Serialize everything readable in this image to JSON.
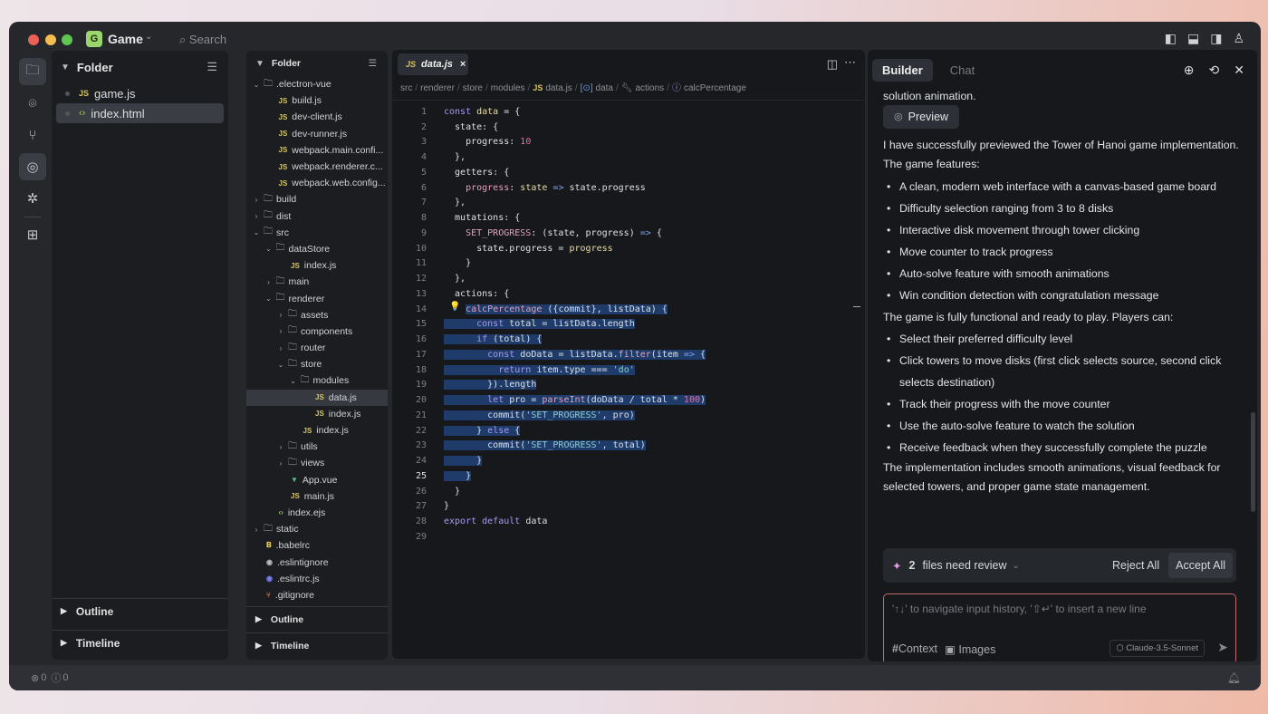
{
  "titlebar": {
    "app_letter": "G",
    "app_name": "Game",
    "search_placeholder": "Search"
  },
  "left_panel": {
    "title": "Folder",
    "files": [
      {
        "icon": "js",
        "name": "game.js"
      },
      {
        "icon": "html",
        "name": "index.html",
        "selected": true
      }
    ],
    "outline": "Outline",
    "timeline": "Timeline"
  },
  "tree": {
    "title": "Folder",
    "items": [
      {
        "d": 0,
        "t": "folder",
        "open": true,
        "name": ".electron-vue"
      },
      {
        "d": 1,
        "t": "js",
        "name": "build.js"
      },
      {
        "d": 1,
        "t": "js",
        "name": "dev-client.js"
      },
      {
        "d": 1,
        "t": "js",
        "name": "dev-runner.js"
      },
      {
        "d": 1,
        "t": "js",
        "name": "webpack.main.confi..."
      },
      {
        "d": 1,
        "t": "js",
        "name": "webpack.renderer.c..."
      },
      {
        "d": 1,
        "t": "js",
        "name": "webpack.web.config..."
      },
      {
        "d": 0,
        "t": "folder",
        "open": false,
        "name": "build"
      },
      {
        "d": 0,
        "t": "folder",
        "open": false,
        "name": "dist"
      },
      {
        "d": 0,
        "t": "folder",
        "open": true,
        "name": "src"
      },
      {
        "d": 1,
        "t": "folder",
        "open": true,
        "name": "dataStore"
      },
      {
        "d": 2,
        "t": "js",
        "name": "index.js"
      },
      {
        "d": 1,
        "t": "folder",
        "open": false,
        "name": "main"
      },
      {
        "d": 1,
        "t": "folder",
        "open": true,
        "name": "renderer"
      },
      {
        "d": 2,
        "t": "folder",
        "open": false,
        "name": "assets"
      },
      {
        "d": 2,
        "t": "folder",
        "open": false,
        "name": "components"
      },
      {
        "d": 2,
        "t": "folder",
        "open": false,
        "name": "router"
      },
      {
        "d": 2,
        "t": "folder",
        "open": true,
        "name": "store"
      },
      {
        "d": 3,
        "t": "folder",
        "open": true,
        "name": "modules"
      },
      {
        "d": 4,
        "t": "js",
        "name": "data.js",
        "selected": true
      },
      {
        "d": 4,
        "t": "js",
        "name": "index.js"
      },
      {
        "d": 3,
        "t": "js",
        "name": "index.js"
      },
      {
        "d": 2,
        "t": "folder",
        "open": false,
        "name": "utils"
      },
      {
        "d": 2,
        "t": "folder",
        "open": false,
        "name": "views"
      },
      {
        "d": 2,
        "t": "vue",
        "name": "App.vue"
      },
      {
        "d": 2,
        "t": "js",
        "name": "main.js"
      },
      {
        "d": 1,
        "t": "html",
        "name": "index.ejs"
      },
      {
        "d": 0,
        "t": "folder",
        "open": false,
        "name": "static"
      },
      {
        "d": 0,
        "t": "babel",
        "name": ".babelrc"
      },
      {
        "d": 0,
        "t": "eslint",
        "name": ".eslintignore"
      },
      {
        "d": 0,
        "t": "eslintrc",
        "name": ".eslintrc.js"
      },
      {
        "d": 0,
        "t": "git",
        "name": ".gitignore"
      }
    ],
    "outline": "Outline",
    "timeline": "Timeline"
  },
  "editor": {
    "tab": "data.js",
    "breadcrumbs": [
      "src",
      "renderer",
      "store",
      "modules",
      "data.js",
      "data",
      "actions",
      "calcPercentage"
    ],
    "current_line": 25,
    "selection": [
      14,
      25
    ],
    "lines": [
      [
        [
          "k",
          "const "
        ],
        [
          "v",
          "data"
        ],
        [
          "t",
          " = {"
        ]
      ],
      [
        [
          "t",
          "  state: {"
        ]
      ],
      [
        [
          "t",
          "    progress: "
        ],
        [
          "n",
          "10"
        ]
      ],
      [
        [
          "t",
          "  },"
        ]
      ],
      [
        [
          "t",
          "  getters: {"
        ]
      ],
      [
        [
          "f",
          "    progress"
        ],
        [
          "t",
          ": "
        ],
        [
          "v",
          "state"
        ],
        [
          "o",
          " => "
        ],
        [
          "t",
          "state.progress"
        ]
      ],
      [
        [
          "t",
          "  },"
        ]
      ],
      [
        [
          "t",
          "  mutations: {"
        ]
      ],
      [
        [
          "f",
          "    SET_PROGRESS"
        ],
        [
          "t",
          ": (state, progress) "
        ],
        [
          "o",
          "=>"
        ],
        [
          "t",
          " {"
        ]
      ],
      [
        [
          "t",
          "      state.progress = "
        ],
        [
          "v",
          "progress"
        ]
      ],
      [
        [
          "t",
          "    }"
        ]
      ],
      [
        [
          "t",
          "  },"
        ]
      ],
      [
        [
          "t",
          "  actions: {"
        ]
      ],
      [
        [
          "t",
          "    "
        ],
        [
          "f",
          "calcPercentage"
        ],
        [
          "t",
          " ({commit}, listData) {"
        ]
      ],
      [
        [
          "k",
          "      const "
        ],
        [
          "t",
          "total = listData.length"
        ]
      ],
      [
        [
          "k",
          "      if"
        ],
        [
          "t",
          " (total) {"
        ]
      ],
      [
        [
          "k",
          "        const "
        ],
        [
          "t",
          "doData = listData."
        ],
        [
          "f",
          "filter"
        ],
        [
          "t",
          "(item "
        ],
        [
          "o",
          "=>"
        ],
        [
          "t",
          " {"
        ]
      ],
      [
        [
          "k",
          "          return "
        ],
        [
          "t",
          "item.type === "
        ],
        [
          "s",
          "'do'"
        ]
      ],
      [
        [
          "t",
          "        }).length"
        ]
      ],
      [
        [
          "k",
          "        let "
        ],
        [
          "t",
          "pro = "
        ],
        [
          "f",
          "parseInt"
        ],
        [
          "t",
          "(doData / total * "
        ],
        [
          "n",
          "100"
        ],
        [
          "t",
          ")"
        ]
      ],
      [
        [
          "t",
          "        commit("
        ],
        [
          "s",
          "'SET_PROGRESS'"
        ],
        [
          "t",
          ", pro)"
        ]
      ],
      [
        [
          "t",
          "      } "
        ],
        [
          "k",
          "else"
        ],
        [
          "t",
          " {"
        ]
      ],
      [
        [
          "t",
          "        commit("
        ],
        [
          "s",
          "'SET_PROGRESS'"
        ],
        [
          "t",
          ", total)"
        ]
      ],
      [
        [
          "t",
          "      }"
        ]
      ],
      [
        [
          "t",
          "    }"
        ]
      ],
      [
        [
          "t",
          "  }"
        ]
      ],
      [
        [
          "t",
          "}"
        ]
      ],
      [
        [
          "k",
          "export default "
        ],
        [
          "t",
          "data"
        ]
      ],
      []
    ]
  },
  "builder": {
    "tabs": [
      "Builder",
      "Chat"
    ],
    "active_tab": "Builder",
    "intro_tail": "solution animation.",
    "preview_label": "Preview",
    "para1": "I have successfully previewed the Tower of Hanoi game implementation. The game features:",
    "features": [
      "A clean, modern web interface with a canvas-based game board",
      "Difficulty selection ranging from 3 to 8 disks",
      "Interactive disk movement through tower clicking",
      "Move counter to track progress",
      "Auto-solve feature with smooth animations",
      "Win condition detection with congratulation message"
    ],
    "para2": "The game is fully functional and ready to play. Players can:",
    "abilities": [
      "Select their preferred difficulty level",
      "Click towers to move disks (first click selects source, second click selects destination)",
      "Track their progress with the move counter",
      "Use the auto-solve feature to watch the solution",
      "Receive feedback when they successfully complete the puzzle"
    ],
    "para3": "The implementation includes smooth animations, visual feedback for selected towers, and proper game state management.",
    "review_count": "2",
    "review_label": "files need review",
    "reject_all": "Reject All",
    "accept_all": "Accept All",
    "input_placeholder": "'↑↓' to navigate input history, '⇧↵' to insert a new line",
    "context_label": "Context",
    "images_label": "Images",
    "model": "Claude-3.5-Sonnet"
  },
  "status": {
    "errors": "0",
    "warnings": "0"
  },
  "colors": {
    "accent_selection": "#1f3b69",
    "app_icon": "#9bd66a",
    "input_border": "#c56a6a"
  }
}
